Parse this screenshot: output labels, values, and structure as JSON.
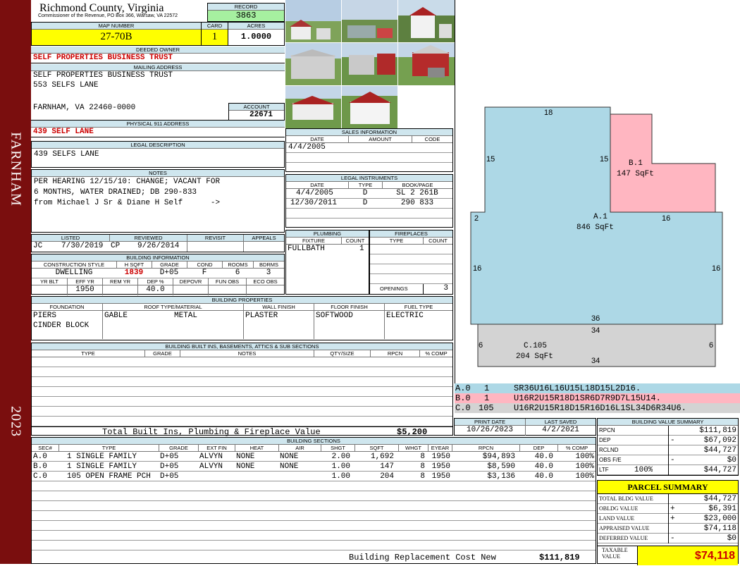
{
  "sidebar": {
    "district": "FARNHAM",
    "year": "2023"
  },
  "header": {
    "county": "Richmond County, Virginia",
    "commissioner": "Commissioner of the Revenue, PO Box 366, Warsaw, VA 22572",
    "record_label": "RECORD",
    "record": "3863",
    "map_label": "MAP NUMBER",
    "map_number": "27-70B",
    "card_label": "CARD",
    "card": "1",
    "acres_label": "ACRES",
    "acres": "1.0000"
  },
  "owner": {
    "deeded_label": "DEEDED OWNER",
    "deeded": "SELF PROPERTIES BUSINESS TRUST",
    "mailing_label": "MAILING ADDRESS",
    "mailing": [
      "SELF PROPERTIES BUSINESS TRUST",
      "553 SELFS LANE",
      "",
      "FARNHAM, VA 22460-0000"
    ],
    "account_label": "ACCOUNT",
    "account": "22671",
    "physical_label": "PHYSICAL 911 ADDRESS",
    "physical": "439 SELF LANE",
    "legal_label": "LEGAL DESCRIPTION",
    "legal": "439 SELFS LANE",
    "notes_label": "NOTES",
    "notes": [
      "PER HEARING 12/15/10: CHANGE; VACANT FOR",
      "6 MONTHS, WATER DRAINED; DB 290-833",
      "from Michael J Sr & Diane H Self      ->"
    ]
  },
  "sales": {
    "title": "SALES INFORMATION",
    "cols": [
      "DATE",
      "AMOUNT",
      "CODE"
    ],
    "rows": [
      {
        "date": "4/4/2005",
        "amount": "",
        "code": ""
      }
    ]
  },
  "legal_instruments": {
    "title": "LEGAL INSTRUMENTS",
    "cols": [
      "DATE",
      "TYPE",
      "BOOK/PAGE"
    ],
    "rows": [
      {
        "date": "4/4/2005",
        "type": "D",
        "book": "SL 2 261B"
      },
      {
        "date": "12/30/2011",
        "type": "D",
        "book": "290 833"
      }
    ]
  },
  "review": {
    "cols": [
      "LISTED",
      "REVIEWED",
      "REVISIT",
      "APPEALS"
    ],
    "listed_by": "JC",
    "listed": "7/30/2019",
    "reviewed_by": "CP",
    "reviewed": "9/26/2014",
    "revisit": "",
    "appeals": ""
  },
  "building_info": {
    "title": "BUILDING INFORMATION",
    "cols1": [
      "CONSTRUCTION STYLE",
      "H SQFT",
      "GRADE",
      "COND",
      "ROOMS",
      "BDRMS"
    ],
    "style": "DWELLING",
    "hsqft": "1839",
    "grade": "D+05",
    "cond": "F",
    "rooms": "6",
    "bdrms": "3",
    "cols2": [
      "YR BLT",
      "EFF YR",
      "REM YR",
      "DEP %",
      "DEPOVR",
      "FUN OBS",
      "ECO OBS"
    ],
    "yr_blt": "",
    "eff_yr": "1950",
    "rem_yr": "",
    "dep": "40.0",
    "depovr": "",
    "fun_obs": "",
    "eco_obs": ""
  },
  "plumbing": {
    "title": "PLUMBING",
    "cols": [
      "FIXTURE",
      "COUNT"
    ],
    "rows": [
      {
        "fixture": "FULLBATH",
        "count": "1"
      }
    ]
  },
  "fireplaces": {
    "title": "FIREPLACES",
    "cols": [
      "TYPE",
      "COUNT"
    ],
    "openings_label": "OPENINGS",
    "openings": "3"
  },
  "building_properties": {
    "title": "BUILDING PROPERTIES",
    "cols": [
      "FOUNDATION",
      "ROOF TYPE/MATERIAL",
      "WALL FINISH",
      "FLOOR FINISH",
      "FUEL TYPE"
    ],
    "foundation": [
      "PIERS",
      "CINDER BLOCK"
    ],
    "roof_type": "GABLE",
    "roof_material": "METAL",
    "wall": "PLASTER",
    "floor": "SOFTWOOD",
    "fuel": "ELECTRIC"
  },
  "builtins": {
    "title": "BUILDING BUILT INS, BASEMENTS, ATTICS & SUB SECTIONS",
    "cols": [
      "TYPE",
      "GRADE",
      "NOTES",
      "QTY/SIZE",
      "RPCN",
      "% COMP"
    ],
    "total_label": "Total Built Ins, Plumbing & Fireplace Value",
    "total": "$5,200"
  },
  "sketch": {
    "labels": [
      {
        "name": "A.1",
        "sqft": "846 SqFt"
      },
      {
        "name": "B.1",
        "sqft": "147 SqFt"
      },
      {
        "name": "C.105",
        "sqft": "204 SqFt"
      }
    ],
    "dims": [
      "18",
      "15",
      "15",
      "2",
      "16",
      "16",
      "16",
      "36",
      "34",
      "6",
      "6",
      "34"
    ],
    "vectors": [
      {
        "sec": "A.0",
        "num": "1",
        "path": "SR36U16L16U15L18D15L2D16."
      },
      {
        "sec": "B.0",
        "num": "1",
        "path": "U16R2U15R18D1SR6D7R9D7L15U14."
      },
      {
        "sec": "C.0",
        "num": "105",
        "path": "U16R2U15R18D15R16D16L1SL34D6R34U6."
      }
    ]
  },
  "dates": {
    "print_label": "PRINT DATE",
    "print": "10/26/2023",
    "saved_label": "LAST SAVED",
    "saved": "4/2/2021"
  },
  "value_summary": {
    "title": "BUILDING VALUE SUMMARY",
    "rows": [
      {
        "label": "RPCN",
        "sign": "",
        "pct": "",
        "value": "$111,819"
      },
      {
        "label": "DEP",
        "sign": "-",
        "pct": "",
        "value": "$67,092"
      },
      {
        "label": "RCLND",
        "sign": "",
        "pct": "",
        "value": "$44,727"
      },
      {
        "label": "OBS F/E",
        "sign": "-",
        "pct": "",
        "value": "$0"
      },
      {
        "label": "LTF",
        "sign": "",
        "pct": "100%",
        "value": "$44,727"
      }
    ]
  },
  "parcel": {
    "title": "PARCEL SUMMARY",
    "rows": [
      {
        "label": "TOTAL BLDG VALUE",
        "sign": "",
        "value": "$44,727"
      },
      {
        "label": "OBLDG VALUE",
        "sign": "+",
        "value": "$6,391"
      },
      {
        "label": "LAND VALUE",
        "sign": "+",
        "value": "$23,000"
      },
      {
        "label": "APPRAISED VALUE",
        "sign": "",
        "value": "$74,118"
      },
      {
        "label": "DEFERRED VALUE",
        "sign": "-",
        "value": "$0"
      }
    ],
    "taxable_label1": "TAXABLE",
    "taxable_label2": "VALUE",
    "taxable": "$74,118"
  },
  "sections": {
    "title": "BUILDING SECTIONS",
    "cols": [
      "SEC#",
      "TYPE",
      "GRADE",
      "EXT FIN",
      "HEAT",
      "AIR",
      "SHGT",
      "SQFT",
      "WHGT",
      "EYEAR",
      "RPCN",
      "DEP",
      "% COMP"
    ],
    "rows": [
      {
        "sec": "A.0",
        "type": "1 SINGLE FAMILY",
        "grade": "D+05",
        "ext": "ALVYN",
        "heat": "NONE",
        "air": "NONE",
        "shgt": "2.00",
        "sqft": "1,692",
        "whgt": "8",
        "eyear": "1950",
        "rpcn": "$94,893",
        "dep": "40.0",
        "comp": "100%"
      },
      {
        "sec": "B.0",
        "type": "1 SINGLE FAMILY",
        "grade": "D+05",
        "ext": "ALVYN",
        "heat": "NONE",
        "air": "NONE",
        "shgt": "1.00",
        "sqft": "147",
        "whgt": "8",
        "eyear": "1950",
        "rpcn": "$8,590",
        "dep": "40.0",
        "comp": "100%"
      },
      {
        "sec": "C.0",
        "type": "105 OPEN FRAME PCH",
        "grade": "D+05",
        "ext": "",
        "heat": "",
        "air": "",
        "shgt": "1.00",
        "sqft": "204",
        "whgt": "8",
        "eyear": "1950",
        "rpcn": "$3,136",
        "dep": "40.0",
        "comp": "100%"
      }
    ],
    "rcn_label": "Building Replacement Cost New",
    "rcn": "$111,819"
  },
  "colors": {
    "sidebar": "#7a0e0e",
    "header_bg": "#cfe6ee",
    "highlight": "#ffff00",
    "record": "#a6f0a0",
    "sketch_a": "#add8e6",
    "sketch_b": "#ffb6c1",
    "sketch_c": "#d3d3d3"
  }
}
